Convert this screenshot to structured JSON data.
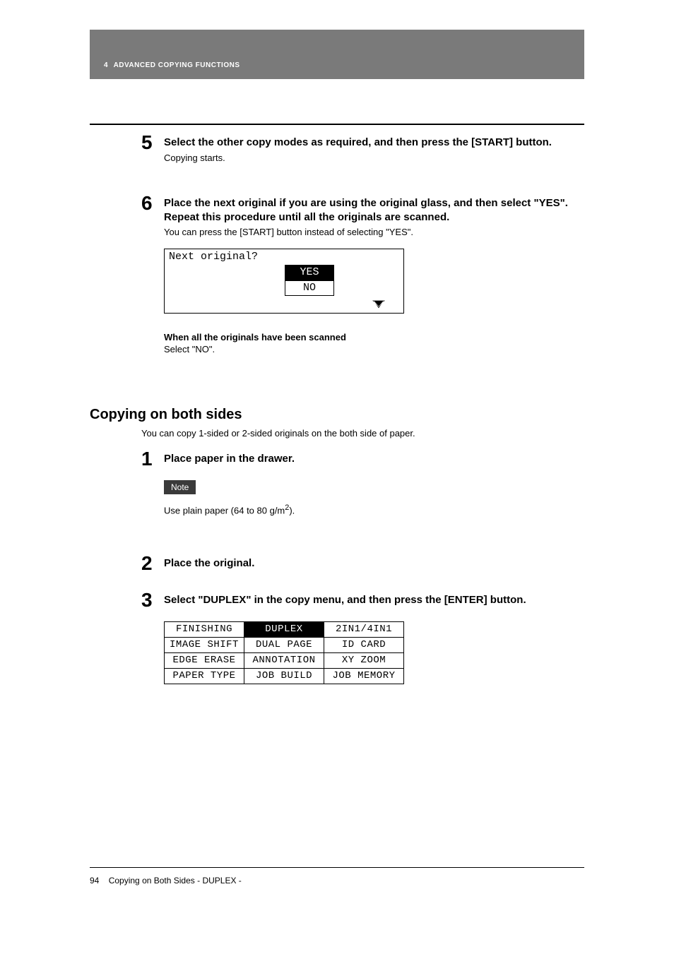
{
  "header": {
    "chapter_number": "4",
    "chapter_title": "ADVANCED COPYING FUNCTIONS"
  },
  "step5": {
    "num": "5",
    "title": "Select the other copy modes as required, and then press the [START] button.",
    "body": "Copying starts."
  },
  "step6": {
    "num": "6",
    "title": "Place the next original if you are using the original glass, and then select \"YES\". Repeat this procedure until all the originals are scanned.",
    "body": "You can press the [START] button instead of selecting \"YES\".",
    "lcd_prompt": "Next original?",
    "lcd_yes": "YES",
    "lcd_no": "NO",
    "after_title": "When all the originals have been scanned",
    "after_body": "Select \"NO\"."
  },
  "section": {
    "heading": "Copying on both sides",
    "intro": "You can copy 1-sided or 2-sided originals on the both side of paper."
  },
  "s1": {
    "num": "1",
    "title": "Place paper in the drawer.",
    "note_label": "Note",
    "note_body_pre": "Use plain paper (64 to 80 g/m",
    "note_body_sup": "2",
    "note_body_post": ")."
  },
  "s2": {
    "num": "2",
    "title": "Place the original."
  },
  "s3": {
    "num": "3",
    "title": "Select \"DUPLEX\" in the copy menu, and then press the [ENTER] button.",
    "menu": {
      "r1c1": "FINISHING",
      "r1c2": "DUPLEX",
      "r1c3": "2IN1/4IN1",
      "r2c1": "IMAGE SHIFT",
      "r2c2": "DUAL PAGE",
      "r2c3": "ID CARD",
      "r3c1": "EDGE ERASE",
      "r3c2": "ANNOTATION",
      "r3c3": "XY ZOOM",
      "r4c1": "PAPER TYPE",
      "r4c2": "JOB BUILD",
      "r4c3": "JOB MEMORY"
    }
  },
  "footer": {
    "page": "94",
    "label": "Copying on Both Sides - DUPLEX -"
  }
}
